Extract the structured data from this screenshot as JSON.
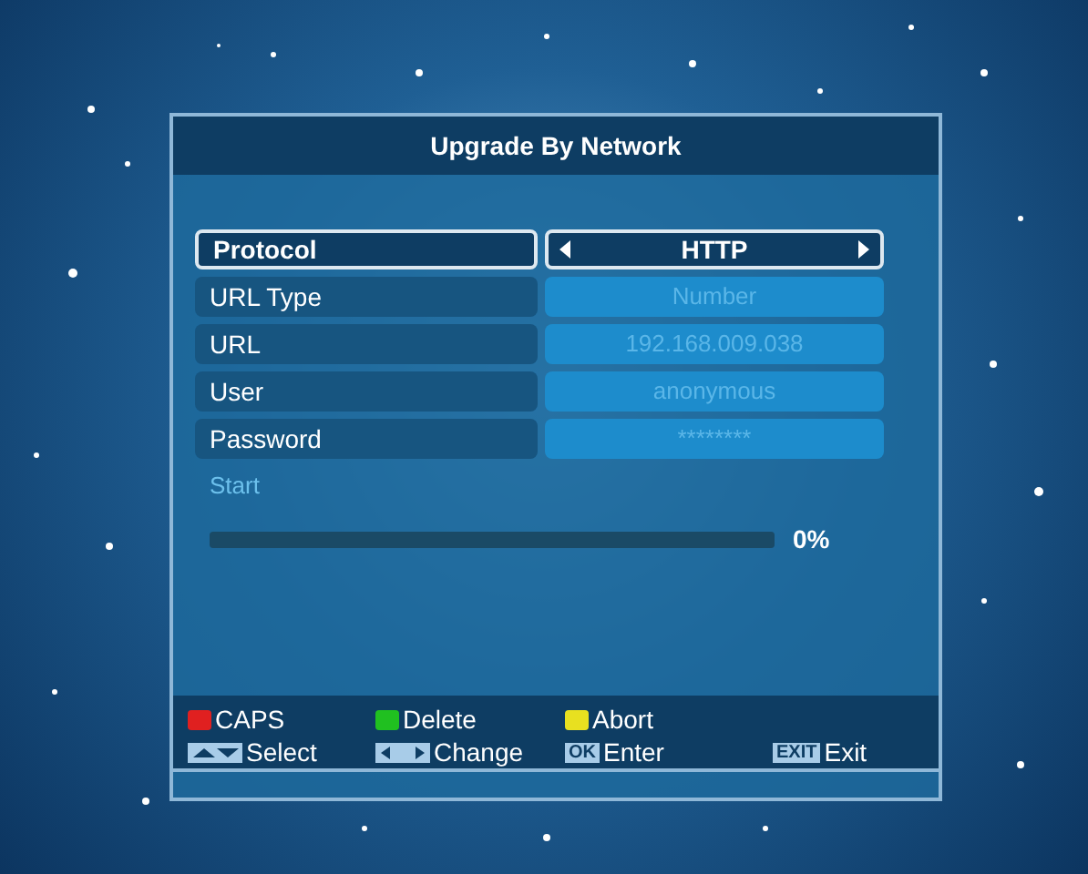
{
  "dialog": {
    "title": "Upgrade By Network",
    "fields": [
      {
        "label": "Protocol",
        "value": "HTTP",
        "selected": true
      },
      {
        "label": "URL Type",
        "value": "Number",
        "selected": false
      },
      {
        "label": "URL",
        "value": "192.168.009.038",
        "selected": false
      },
      {
        "label": "User",
        "value": "anonymous",
        "selected": false
      },
      {
        "label": "Password",
        "value": "********",
        "selected": false
      }
    ],
    "start": "Start",
    "progress": {
      "level": 0,
      "reading": "0%"
    },
    "hint_rows": [
      [
        {
          "kind": "color",
          "color": "#e02020",
          "label": "CAPS"
        },
        {
          "kind": "color",
          "color": "#20c020",
          "label": "Delete"
        },
        {
          "kind": "color",
          "color": "#e8e020",
          "label": "Abort"
        }
      ],
      [
        {
          "kind": "updown",
          "label": "Select"
        },
        {
          "kind": "leftright",
          "label": "Change"
        },
        {
          "kind": "key",
          "key": "OK",
          "label": "Enter"
        },
        {
          "kind": "key",
          "key": "EXIT",
          "label": "Exit"
        }
      ]
    ]
  }
}
